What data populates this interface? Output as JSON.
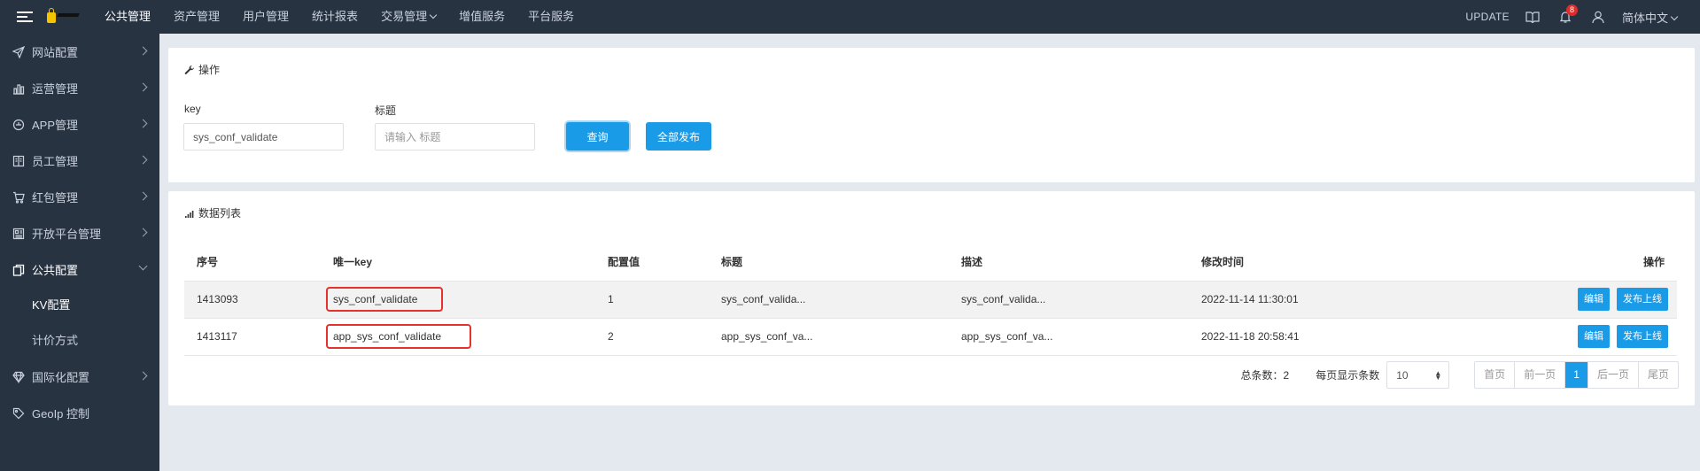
{
  "topbar": {
    "nav": [
      {
        "label": "公共管理",
        "active": true
      },
      {
        "label": "资产管理"
      },
      {
        "label": "用户管理"
      },
      {
        "label": "统计报表"
      },
      {
        "label": "交易管理",
        "dropdown": true
      },
      {
        "label": "增值服务"
      },
      {
        "label": "平台服务"
      }
    ],
    "update_label": "UPDATE",
    "notification_count": "8",
    "language": "简体中文"
  },
  "sidebar": {
    "items": [
      {
        "label": "网站配置",
        "icon": "send-icon"
      },
      {
        "label": "运营管理",
        "icon": "bar-chart-icon"
      },
      {
        "label": "APP管理",
        "icon": "app-icon"
      },
      {
        "label": "员工管理",
        "icon": "book-icon"
      },
      {
        "label": "红包管理",
        "icon": "cart-icon"
      },
      {
        "label": "开放平台管理",
        "icon": "grid-icon"
      },
      {
        "label": "公共配置",
        "icon": "copy-icon",
        "open": true
      },
      {
        "label": "国际化配置",
        "icon": "diamond-icon"
      },
      {
        "label": "GeoIp 控制",
        "icon": "tag-icon"
      }
    ],
    "sub_items": [
      {
        "label": "KV配置",
        "active": true
      },
      {
        "label": "计价方式"
      }
    ]
  },
  "ops_panel": {
    "title": "操作",
    "key_label": "key",
    "key_value": "sys_conf_validate",
    "title_label": "标题",
    "title_placeholder": "请输入 标题",
    "query_button": "查询",
    "publish_all_button": "全部发布"
  },
  "list_panel": {
    "title": "数据列表",
    "columns": [
      "序号",
      "唯一key",
      "配置值",
      "标题",
      "描述",
      "修改时间",
      "操作"
    ],
    "rows": [
      {
        "id": "1413093",
        "key": "sys_conf_validate",
        "value": "1",
        "title": "sys_conf_valida...",
        "desc": "sys_conf_valida...",
        "modified": "2022-11-14 11:30:01"
      },
      {
        "id": "1413117",
        "key": "app_sys_conf_validate",
        "value": "2",
        "title": "app_sys_conf_va...",
        "desc": "app_sys_conf_va...",
        "modified": "2022-11-18 20:58:41"
      }
    ],
    "edit_button": "编辑",
    "publish_button": "发布上线",
    "total_label": "总条数：",
    "total": "2",
    "per_page_label": "每页显示条数",
    "per_page": "10",
    "pager": {
      "first": "首页",
      "prev": "前一页",
      "current": "1",
      "next": "后一页",
      "last": "尾页"
    }
  },
  "colors": {
    "topbar": "#283342",
    "primary": "#1a9be8",
    "highlight": "#e5322d"
  }
}
